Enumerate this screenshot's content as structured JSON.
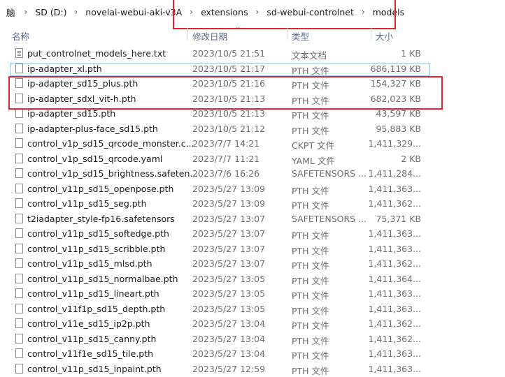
{
  "breadcrumb": {
    "items": [
      "脑",
      "SD (D:)",
      "novelai-webui-aki-v3A",
      "extensions",
      "sd-webui-controlnet",
      "models"
    ],
    "separator": "›"
  },
  "columns": {
    "name": "名称",
    "date": "修改日期",
    "type": "类型",
    "size": "大小"
  },
  "files": [
    {
      "name": "put_controlnet_models_here.txt",
      "date": "2023/10/5 21:51",
      "type": "文本文档",
      "size": "1 KB",
      "icon": "text-file-icon"
    },
    {
      "name": "ip-adapter_xl.pth",
      "date": "2023/10/5 21:17",
      "type": "PTH 文件",
      "size": "686,119 KB",
      "icon": "file-icon"
    },
    {
      "name": "ip-adapter_sd15_plus.pth",
      "date": "2023/10/5 21:16",
      "type": "PTH 文件",
      "size": "154,327 KB",
      "icon": "file-icon"
    },
    {
      "name": "ip-adapter_sdxl_vit-h.pth",
      "date": "2023/10/5 21:13",
      "type": "PTH 文件",
      "size": "682,023 KB",
      "icon": "file-icon"
    },
    {
      "name": "ip-adapter_sd15.pth",
      "date": "2023/10/5 21:13",
      "type": "PTH 文件",
      "size": "43,597 KB",
      "icon": "file-icon"
    },
    {
      "name": "ip-adapter-plus-face_sd15.pth",
      "date": "2023/10/5 21:12",
      "type": "PTH 文件",
      "size": "95,883 KB",
      "icon": "file-icon"
    },
    {
      "name": "control_v1p_sd15_qrcode_monster.c...",
      "date": "2023/7/7 14:21",
      "type": "CKPT 文件",
      "size": "1,411,329...",
      "icon": "file-icon"
    },
    {
      "name": "control_v1p_sd15_qrcode.yaml",
      "date": "2023/7/7 11:21",
      "type": "YAML 文件",
      "size": "2 KB",
      "icon": "file-icon"
    },
    {
      "name": "control_v1p_sd15_brightness.safeten...",
      "date": "2023/7/6 16:26",
      "type": "SAFETENSORS ...",
      "size": "1,411,284...",
      "icon": "file-icon"
    },
    {
      "name": "control_v11p_sd15_openpose.pth",
      "date": "2023/5/27 13:09",
      "type": "PTH 文件",
      "size": "1,411,363...",
      "icon": "file-icon"
    },
    {
      "name": "control_v11p_sd15_seg.pth",
      "date": "2023/5/27 13:09",
      "type": "PTH 文件",
      "size": "1,411,362...",
      "icon": "file-icon"
    },
    {
      "name": "t2iadapter_style-fp16.safetensors",
      "date": "2023/5/27 13:07",
      "type": "SAFETENSORS ...",
      "size": "75,371 KB",
      "icon": "file-icon"
    },
    {
      "name": "control_v11p_sd15_softedge.pth",
      "date": "2023/5/27 13:07",
      "type": "PTH 文件",
      "size": "1,411,363...",
      "icon": "file-icon"
    },
    {
      "name": "control_v11p_sd15_scribble.pth",
      "date": "2023/5/27 13:07",
      "type": "PTH 文件",
      "size": "1,411,363...",
      "icon": "file-icon"
    },
    {
      "name": "control_v11p_sd15_mlsd.pth",
      "date": "2023/5/27 13:07",
      "type": "PTH 文件",
      "size": "1,411,362...",
      "icon": "file-icon"
    },
    {
      "name": "control_v11p_sd15_normalbae.pth",
      "date": "2023/5/27 13:05",
      "type": "PTH 文件",
      "size": "1,411,364...",
      "icon": "file-icon"
    },
    {
      "name": "control_v11p_sd15_lineart.pth",
      "date": "2023/5/27 13:05",
      "type": "PTH 文件",
      "size": "1,411,363...",
      "icon": "file-icon"
    },
    {
      "name": "control_v11f1p_sd15_depth.pth",
      "date": "2023/5/27 13:05",
      "type": "PTH 文件",
      "size": "1,411,363...",
      "icon": "file-icon"
    },
    {
      "name": "control_v11e_sd15_ip2p.pth",
      "date": "2023/5/27 13:04",
      "type": "PTH 文件",
      "size": "1,411,362...",
      "icon": "file-icon"
    },
    {
      "name": "control_v11p_sd15_canny.pth",
      "date": "2023/5/27 13:04",
      "type": "PTH 文件",
      "size": "1,411,362...",
      "icon": "file-icon"
    },
    {
      "name": "control_v11f1e_sd15_tile.pth",
      "date": "2023/5/27 13:04",
      "type": "PTH 文件",
      "size": "1,411,363...",
      "icon": "file-icon"
    },
    {
      "name": "control_v11p_sd15_inpaint.pth",
      "date": "2023/5/27 12:59",
      "type": "PTH 文件",
      "size": "1,411,363...",
      "icon": "file-icon"
    }
  ],
  "colors": {
    "highlight_border": "#e0262b",
    "header_text": "#5b6b88",
    "secondary_text": "#6d6d6d"
  }
}
